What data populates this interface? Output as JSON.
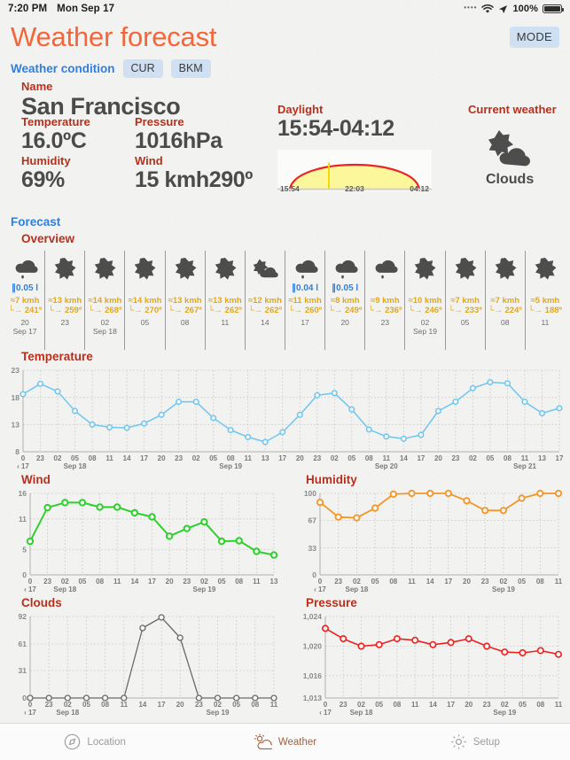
{
  "status_bar": {
    "time": "7:20 PM",
    "date": "Mon Sep 17",
    "wifi_icon": "wifi-icon",
    "location_icon": "location-arrow-icon",
    "battery_text": "100%",
    "battery_icon": "battery-full-icon"
  },
  "header": {
    "title": "Weather forecast",
    "mode_button": "MODE",
    "accent_color": "#f4663a"
  },
  "weather_condition": {
    "section_title": "Weather condition",
    "buttons": [
      "CUR",
      "BKM"
    ],
    "fields": [
      {
        "label": "Name",
        "value": "San Francisco"
      },
      {
        "label": "Temperature",
        "value": "16.0ºC"
      },
      {
        "label": "Pressure",
        "value": "1016hPa"
      },
      {
        "label": "Humidity",
        "value": "69%"
      },
      {
        "label": "Wind",
        "value": "15 kmh290º"
      },
      {
        "label": "Daylight",
        "value": "15:54-04:12"
      },
      {
        "label": "Current weather",
        "value": "Clouds"
      }
    ],
    "daylight": {
      "label": "Daylight",
      "value": "15:54-04:12",
      "sunrise": "15:54",
      "noon": "22:03",
      "sunset": "04:12",
      "arc_color": "#ee2222",
      "fill_color": "#fbf79a",
      "marker_color": "#f2d800"
    },
    "current_weather": {
      "label": "Current weather",
      "condition": "Clouds",
      "icon": "cloud-sun-icon"
    }
  },
  "forecast": {
    "section_title": "Forecast",
    "overview_title": "Overview",
    "columns": [
      {
        "icon": "rain-cloud-icon",
        "rain": "∥0.05 l",
        "wind": "≈7 kmh",
        "dir": "└→ 241º",
        "hour": "20",
        "day": "Sep 17"
      },
      {
        "icon": "sun-icon",
        "rain": "",
        "wind": "≈13 kmh",
        "dir": "└→ 259º",
        "hour": "23",
        "day": ""
      },
      {
        "icon": "sun-icon",
        "rain": "",
        "wind": "≈14 kmh",
        "dir": "└→ 268º",
        "hour": "02",
        "day": "Sep 18"
      },
      {
        "icon": "sun-icon",
        "rain": "",
        "wind": "≈14 kmh",
        "dir": "└→ 270º",
        "hour": "05",
        "day": ""
      },
      {
        "icon": "sun-icon",
        "rain": "",
        "wind": "≈13 kmh",
        "dir": "└→ 267º",
        "hour": "08",
        "day": ""
      },
      {
        "icon": "sun-icon",
        "rain": "",
        "wind": "≈13 kmh",
        "dir": "└→ 262º",
        "hour": "11",
        "day": ""
      },
      {
        "icon": "cloud-sun-icon",
        "rain": "",
        "wind": "≈12 kmh",
        "dir": "└→ 262º",
        "hour": "14",
        "day": ""
      },
      {
        "icon": "rain-cloud-icon",
        "rain": "∥0.04 l",
        "wind": "≈11 kmh",
        "dir": "└→ 260º",
        "hour": "17",
        "day": ""
      },
      {
        "icon": "rain-cloud-icon",
        "rain": "∥0.05 l",
        "wind": "≈8 kmh",
        "dir": "└→ 249º",
        "hour": "20",
        "day": ""
      },
      {
        "icon": "rain-cloud-icon",
        "rain": "",
        "wind": "≈9 kmh",
        "dir": "└→ 236º",
        "hour": "23",
        "day": ""
      },
      {
        "icon": "sun-icon",
        "rain": "",
        "wind": "≈10 kmh",
        "dir": "└→ 246º",
        "hour": "02",
        "day": "Sep 19"
      },
      {
        "icon": "sun-icon",
        "rain": "",
        "wind": "≈7 kmh",
        "dir": "└→ 233º",
        "hour": "05",
        "day": ""
      },
      {
        "icon": "sun-icon",
        "rain": "",
        "wind": "≈7 kmh",
        "dir": "└→ 224º",
        "hour": "08",
        "day": ""
      },
      {
        "icon": "sun-icon",
        "rain": "",
        "wind": "≈5 kmh",
        "dir": "└→ 188º",
        "hour": "11",
        "day": ""
      }
    ]
  },
  "chart_data": [
    {
      "type": "line",
      "name": "temperature",
      "title": "Temperature",
      "color": "#6ec6f0",
      "title_color": "#b8301c",
      "ylim": [
        8,
        23
      ],
      "yticks": [
        8,
        13,
        18,
        23
      ],
      "ytick_labels": [
        "8",
        "13",
        "18",
        "23"
      ],
      "grid": true,
      "xlabel": "",
      "ylabel": "",
      "xtick_labels": [
        "0",
        "23",
        "02",
        "05",
        "08",
        "11",
        "14",
        "17",
        "20",
        "23",
        "02",
        "05",
        "08",
        "11",
        "13",
        "17",
        "20",
        "23",
        "02",
        "05",
        "08",
        "11",
        "14",
        "17",
        "20",
        "23",
        "02",
        "05",
        "08",
        "11",
        "13",
        "17"
      ],
      "day_labels": [
        {
          "index": 0,
          "text": "‹ 17"
        },
        {
          "index": 3,
          "text": "Sep 18"
        },
        {
          "index": 12,
          "text": "Sep 19"
        },
        {
          "index": 21,
          "text": "Sep 20"
        },
        {
          "index": 29,
          "text": "Sep 21"
        }
      ],
      "values": [
        18.6,
        20.5,
        19.1,
        15.5,
        13.0,
        12.5,
        12.4,
        13.2,
        14.8,
        17.2,
        17.2,
        14.2,
        12.0,
        10.7,
        9.8,
        11.6,
        14.8,
        18.4,
        18.8,
        15.8,
        12.1,
        10.8,
        10.4,
        11.1,
        15.5,
        17.2,
        19.7,
        20.8,
        20.6,
        17.2,
        15.1,
        16.0
      ]
    },
    {
      "type": "line",
      "name": "wind",
      "title": "Wind",
      "color": "#2ed02e",
      "title_color": "#b8301c",
      "ylim": [
        0,
        16
      ],
      "yticks": [
        0,
        5,
        11,
        16
      ],
      "ytick_labels": [
        "0",
        "5",
        "11",
        "16"
      ],
      "grid": true,
      "xtick_labels": [
        "0",
        "23",
        "02",
        "05",
        "08",
        "11",
        "14",
        "17",
        "20",
        "23",
        "02",
        "05",
        "08",
        "11",
        "13"
      ],
      "day_labels": [
        {
          "index": 0,
          "text": "‹ 17"
        },
        {
          "index": 2,
          "text": "Sep 18"
        },
        {
          "index": 10,
          "text": "Sep 19"
        }
      ],
      "values": [
        6.6,
        13.2,
        14.2,
        14.2,
        13.3,
        13.3,
        12.2,
        11.4,
        7.6,
        9.1,
        10.4,
        6.6,
        6.7,
        4.6,
        3.9
      ]
    },
    {
      "type": "line",
      "name": "humidity",
      "title": "Humidity",
      "color": "#f29628",
      "title_color": "#b8301c",
      "ylim": [
        0,
        100
      ],
      "yticks": [
        0,
        33,
        67,
        100
      ],
      "ytick_labels": [
        "0",
        "33",
        "67",
        "100"
      ],
      "grid": true,
      "xtick_labels": [
        "0",
        "23",
        "02",
        "05",
        "08",
        "11",
        "14",
        "17",
        "20",
        "23",
        "02",
        "05",
        "08",
        "11"
      ],
      "day_labels": [
        {
          "index": 0,
          "text": "‹ 17"
        },
        {
          "index": 2,
          "text": "Sep 18"
        },
        {
          "index": 10,
          "text": "Sep 19"
        }
      ],
      "values": [
        89,
        71,
        70,
        82,
        99,
        100,
        100,
        100,
        91,
        79,
        79,
        94,
        100,
        100
      ]
    },
    {
      "type": "line",
      "name": "clouds",
      "title": "Clouds",
      "color": "#6a6a6a",
      "title_color": "#b8301c",
      "ylim": [
        0,
        92
      ],
      "yticks": [
        0,
        31,
        61,
        92
      ],
      "ytick_labels": [
        "0",
        "31",
        "61",
        "92"
      ],
      "grid": true,
      "xtick_labels": [
        "0",
        "23",
        "02",
        "05",
        "08",
        "11",
        "14",
        "17",
        "20",
        "23",
        "02",
        "05",
        "08",
        "11"
      ],
      "day_labels": [
        {
          "index": 0,
          "text": "‹ 17"
        },
        {
          "index": 2,
          "text": "Sep 18"
        },
        {
          "index": 10,
          "text": "Sep 19"
        }
      ],
      "values": [
        0,
        0,
        0,
        0,
        0,
        0,
        79,
        91,
        68,
        0,
        0,
        0,
        0,
        0
      ]
    },
    {
      "type": "line",
      "name": "pressure",
      "title": "Pressure",
      "color": "#ee2020",
      "title_color": "#b8301c",
      "ylim": [
        1013,
        1024
      ],
      "yticks": [
        1013,
        1016,
        1020,
        1024
      ],
      "ytick_labels": [
        "1,013",
        "1,016",
        "1,020",
        "1,024"
      ],
      "grid": true,
      "xtick_labels": [
        "0",
        "23",
        "02",
        "05",
        "08",
        "11",
        "14",
        "17",
        "20",
        "23",
        "02",
        "05",
        "08",
        "11"
      ],
      "day_labels": [
        {
          "index": 0,
          "text": "‹ 17"
        },
        {
          "index": 2,
          "text": "Sep 18"
        },
        {
          "index": 10,
          "text": "Sep 19"
        }
      ],
      "values": [
        1022.4,
        1021.0,
        1020.0,
        1020.2,
        1021.0,
        1020.8,
        1020.2,
        1020.5,
        1021.0,
        1020.0,
        1019.2,
        1019.1,
        1019.4,
        1018.9
      ]
    }
  ],
  "tabbar": {
    "tabs": [
      {
        "label": "Location",
        "icon": "compass-icon",
        "active": false
      },
      {
        "label": "Weather",
        "icon": "cloud-sun-icon",
        "active": true
      },
      {
        "label": "Setup",
        "icon": "gear-icon",
        "active": false
      }
    ],
    "active_color": "#a4603a",
    "inactive_color": "#9b9b9b"
  }
}
